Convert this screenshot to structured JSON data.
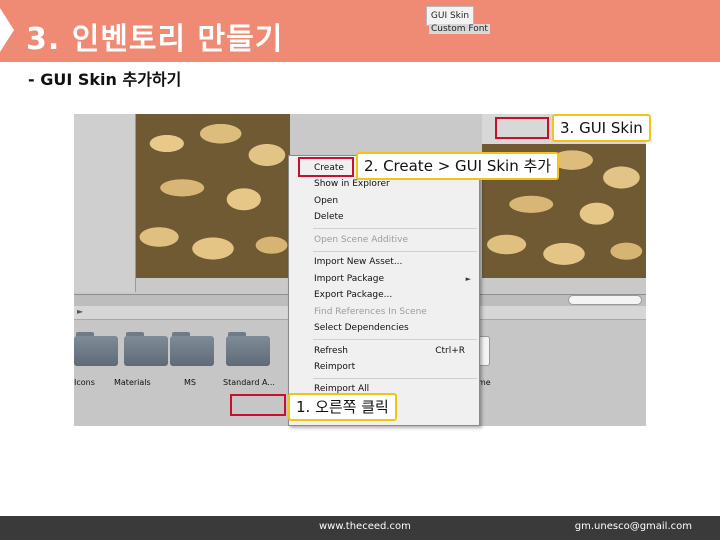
{
  "slide": {
    "title": "3. 인벤토리 만들기",
    "subtitle": "- GUI Skin 추가하기"
  },
  "colors": {
    "title_bar": "#ef8a75",
    "callout_border": "#f2c318",
    "highlight_box": "#c8102e",
    "footer": "#3a3a3a"
  },
  "inspector": {
    "gui_skin_field": "GUI Skin",
    "custom_font_label": "Custom Font"
  },
  "project_folders": [
    "Icons",
    "Materials",
    "MS",
    "Standard A..."
  ],
  "asset_label_partial": "me",
  "context_menu": {
    "items": [
      {
        "label": "Create",
        "enabled": true
      },
      {
        "label": "Show in Explorer",
        "enabled": true
      },
      {
        "label": "Open",
        "enabled": true
      },
      {
        "label": "Delete",
        "enabled": true
      },
      {
        "label": "Open Scene Additive",
        "enabled": false
      },
      {
        "label": "Import New Asset...",
        "enabled": true
      },
      {
        "label": "Import Package",
        "enabled": true,
        "submenu": true
      },
      {
        "label": "Export Package...",
        "enabled": true
      },
      {
        "label": "Find References In Scene",
        "enabled": false
      },
      {
        "label": "Select Dependencies",
        "enabled": true
      },
      {
        "label": "Refresh",
        "enabled": true,
        "shortcut": "Ctrl+R"
      },
      {
        "label": "Reimport",
        "enabled": true
      },
      {
        "label": "Reimport All",
        "enabled": true
      }
    ]
  },
  "callouts": {
    "step1": "1. 오른쪽 클릭",
    "step2": "2. Create > GUI Skin 추가",
    "step3": "3. GUI Skin"
  },
  "footer": {
    "site": "www.theceed.com",
    "email": "gm.unesco@gmail.com"
  }
}
